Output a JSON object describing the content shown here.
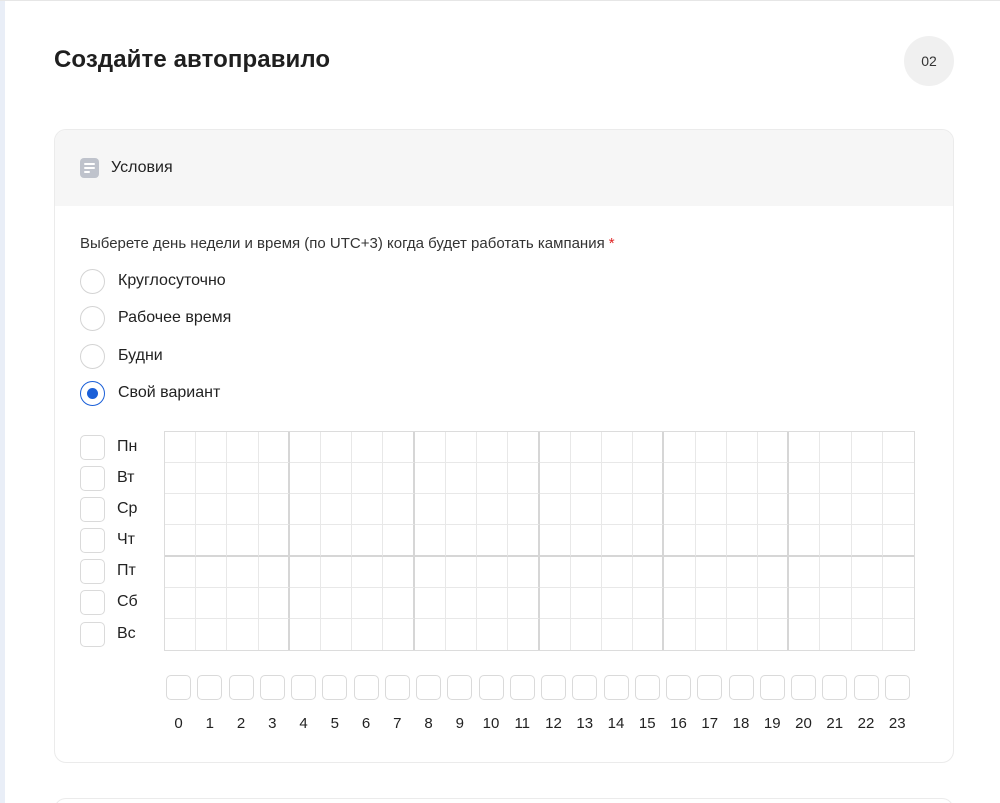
{
  "page": {
    "title": "Создайте автоправило",
    "step": "02"
  },
  "conditions": {
    "header": "Условия",
    "question": "Выберете день недели и время (по UTC+3) когда будет работать кампания",
    "required_mark": "*",
    "options": [
      {
        "label": "Круглосуточно",
        "checked": false
      },
      {
        "label": "Рабочее время",
        "checked": false
      },
      {
        "label": "Будни",
        "checked": false
      },
      {
        "label": "Свой вариант",
        "checked": true
      }
    ],
    "days": [
      "Пн",
      "Вт",
      "Ср",
      "Чт",
      "Пт",
      "Сб",
      "Вс"
    ],
    "hours": [
      "0",
      "1",
      "2",
      "3",
      "4",
      "5",
      "6",
      "7",
      "8",
      "9",
      "10",
      "11",
      "12",
      "13",
      "14",
      "15",
      "16",
      "17",
      "18",
      "19",
      "20",
      "21",
      "22",
      "23"
    ]
  },
  "colors": {
    "accent": "#1a5fd8",
    "required": "#e02424"
  }
}
